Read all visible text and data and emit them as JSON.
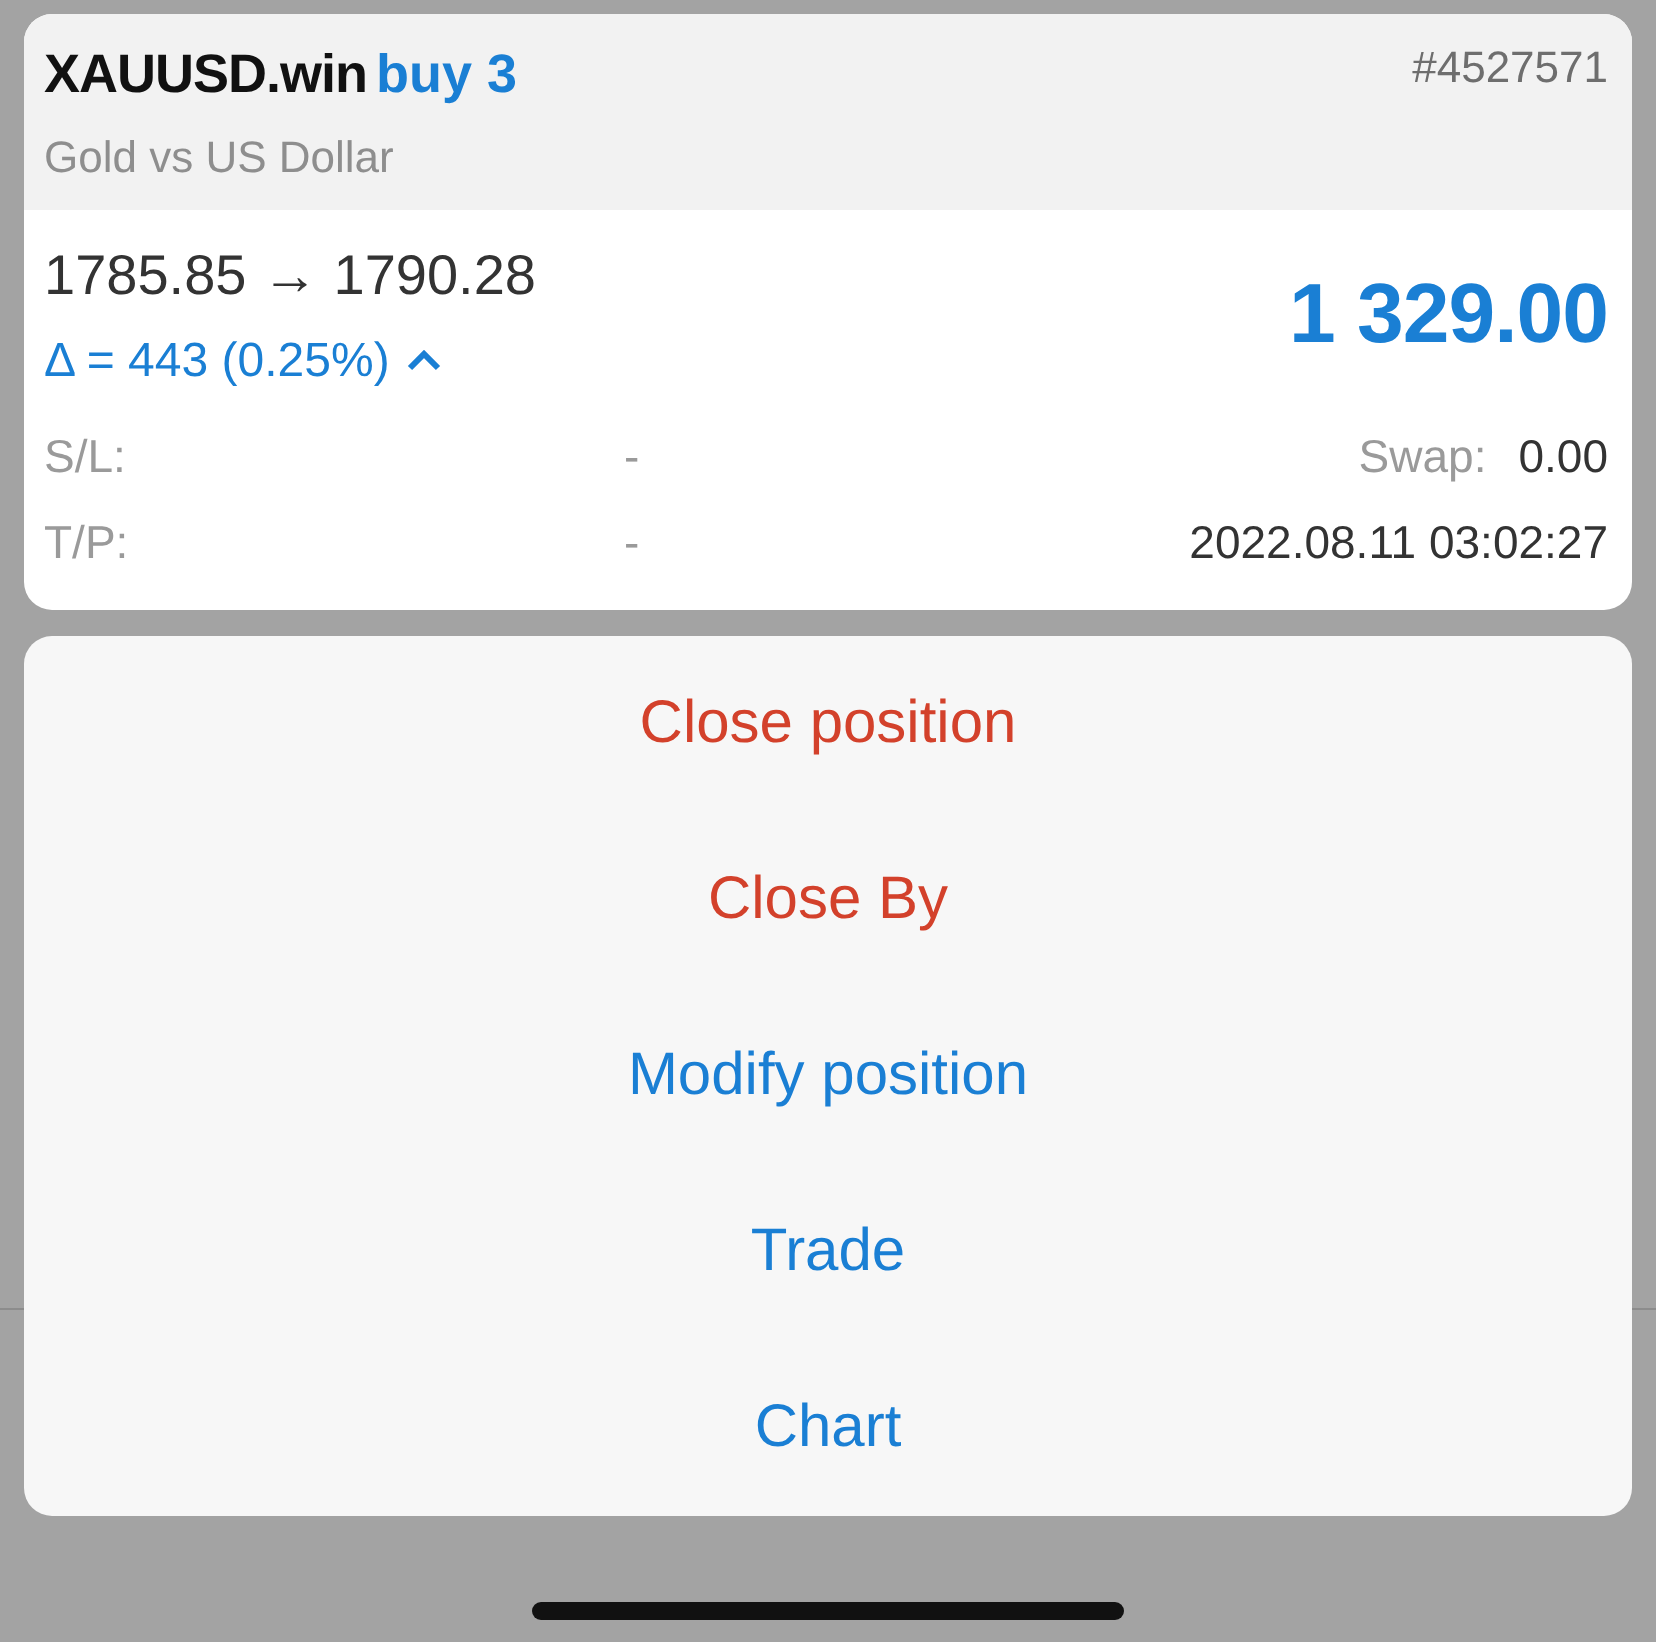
{
  "position": {
    "symbol": "XAUUSD.win",
    "side": "buy 3",
    "ticket": "#4527571",
    "description": "Gold vs US Dollar",
    "prices": "1785.85 → 1790.28",
    "delta": "Δ = 443 (0.25%)",
    "expanded": true,
    "profit": "1 329.00",
    "details": [
      {
        "label": "S/L:",
        "value": "-",
        "label_2": "Swap:",
        "value_2": "0.00"
      },
      {
        "label": "T/P:",
        "value": "-",
        "value_2": "2022.08.11 03:02:27"
      }
    ]
  },
  "actions": [
    {
      "label": "Close position",
      "kind": "destructive"
    },
    {
      "label": "Close By",
      "kind": "destructive"
    },
    {
      "label": "Modify position",
      "kind": "default"
    },
    {
      "label": "Trade",
      "kind": "default"
    },
    {
      "label": "Chart",
      "kind": "default"
    }
  ]
}
